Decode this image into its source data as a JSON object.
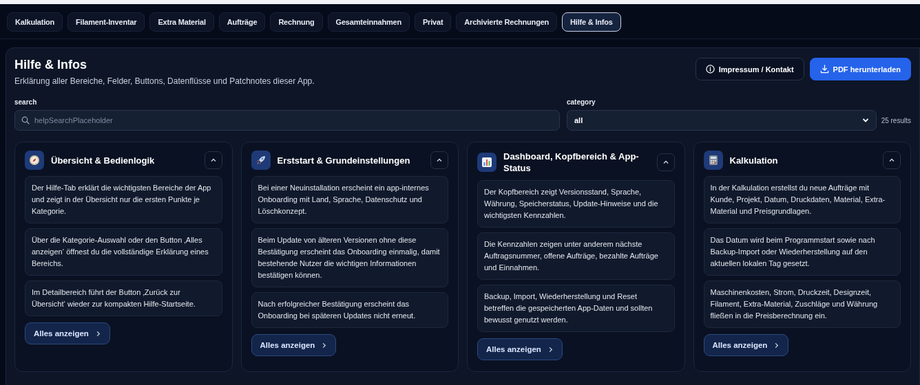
{
  "tabs": [
    {
      "label": "Kalkulation",
      "selected": false
    },
    {
      "label": "Filament-Inventar",
      "selected": false
    },
    {
      "label": "Extra Material",
      "selected": false
    },
    {
      "label": "Aufträge",
      "selected": false
    },
    {
      "label": "Rechnung",
      "selected": false
    },
    {
      "label": "Gesamteinnahmen",
      "selected": false
    },
    {
      "label": "Privat",
      "selected": false
    },
    {
      "label": "Archivierte Rechnungen",
      "selected": false
    },
    {
      "label": "Hilfe & Infos",
      "selected": true
    }
  ],
  "header": {
    "title": "Hilfe & Infos",
    "subtitle": "Erklärung aller Bereiche, Felder, Buttons, Datenflüsse und Patchnotes dieser App.",
    "buttons": [
      {
        "label": "Impressum / Kontakt",
        "kind": "secondary"
      },
      {
        "label": "PDF herunterladen",
        "kind": "primary"
      }
    ]
  },
  "filters": {
    "search_label": "search",
    "search_placeholder": "helpSearchPlaceholder",
    "category_label": "category",
    "category_value": "all",
    "result_count": "25 results"
  },
  "cards": [
    {
      "title": "Übersicht & Bedienlogik",
      "expanded": true,
      "items": [
        "Der Hilfe-Tab erklärt die wichtigsten Bereiche der App und zeigt in der Übersicht nur die ersten Punkte je Kategorie.",
        "Über die Kategorie-Auswahl oder den Button ‚Alles anzeigen‘ öffnest du die vollständige Erklärung eines Bereichs.",
        "Im Detailbereich führt der Button ‚Zurück zur Übersicht‘ wieder zur kompakten Hilfe-Startseite."
      ],
      "button": "Alles anzeigen"
    },
    {
      "title": "Erststart & Grundeinstellungen",
      "expanded": true,
      "items": [
        "Bei einer Neuinstallation erscheint ein app-internes Onboarding mit Land, Sprache, Datenschutz und Löschkonzept.",
        "Beim Update von älteren Versionen ohne diese Bestätigung erscheint das Onboarding einmalig, damit bestehende Nutzer die wichtigen Informationen bestätigen können.",
        "Nach erfolgreicher Bestätigung erscheint das Onboarding bei späteren Updates nicht erneut."
      ],
      "button": "Alles anzeigen"
    },
    {
      "title": "Dashboard, Kopfbereich & App-Status",
      "expanded": true,
      "items": [
        "Der Kopfbereich zeigt Versionsstand, Sprache, Währung, Speicherstatus, Update-Hinweise und die wichtigsten Kennzahlen.",
        "Die Kennzahlen zeigen unter anderem nächste Auftragsnummer, offene Aufträge, bezahlte Aufträge und Einnahmen.",
        "Backup, Import, Wiederherstellung und Reset betreffen die gespeicherten App-Daten und sollten bewusst genutzt werden."
      ],
      "button": "Alles anzeigen"
    },
    {
      "title": "Kalkulation",
      "expanded": true,
      "items": [
        "In der Kalkulation erstellst du neue Aufträge mit Kunde, Projekt, Datum, Druckdaten, Material, Extra-Material und Preisgrundlagen.",
        "Das Datum wird beim Programmstart sowie nach Backup-Import oder Wiederherstellung auf den aktuellen lokalen Tag gesetzt.",
        "Maschinenkosten, Strom, Druckzeit, Designzeit, Filament, Extra-Material, Zuschläge und Währung fließen in die Preisberechnung ein."
      ],
      "button": "Alles anzeigen"
    }
  ]
}
